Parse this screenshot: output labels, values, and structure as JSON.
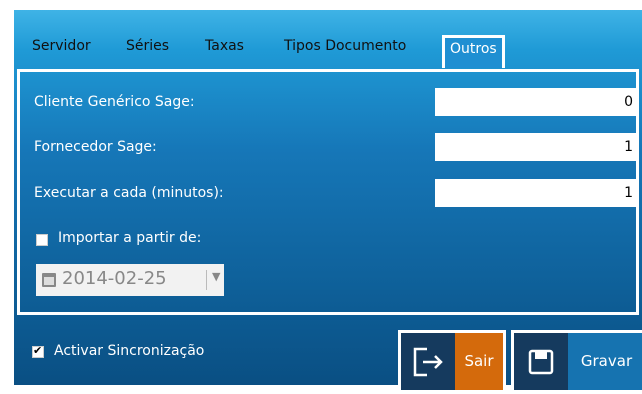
{
  "tabs": [
    {
      "label": "Servidor"
    },
    {
      "label": "Séries"
    },
    {
      "label": "Taxas"
    },
    {
      "label": "Tipos Documento"
    },
    {
      "label": "Outros"
    }
  ],
  "fields": {
    "cliente_generico": {
      "label": "Cliente Genérico Sage:",
      "value": "0"
    },
    "fornecedor": {
      "label": "Fornecedor Sage:",
      "value": "1"
    },
    "executar": {
      "label": "Executar a cada (minutos):",
      "value": "1"
    }
  },
  "importar": {
    "label": "Importar a partir de:",
    "checked": false
  },
  "date_picker": {
    "value": "2014-02-25"
  },
  "activar": {
    "label": "Activar Sincronização",
    "checked": true
  },
  "buttons": {
    "sair": "Sair",
    "gravar": "Gravar"
  },
  "colors": {
    "sair_accent": "#d46a0c",
    "gravar_accent": "#1673b0",
    "icon_bg": "#153a5e"
  }
}
